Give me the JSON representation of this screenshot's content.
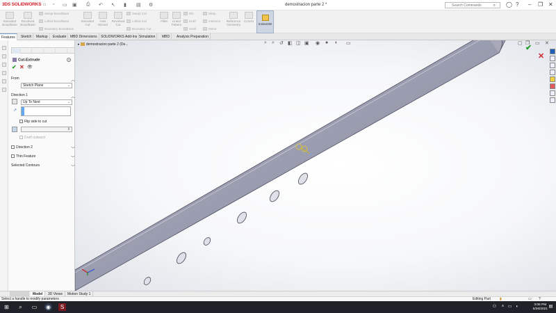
{
  "app": {
    "brand_prefix": "3DS",
    "brand_name": "SOLIDWORKS",
    "document_title": "demostracion parte 2 *"
  },
  "search": {
    "placeholder": "Search Commands"
  },
  "ribbon": {
    "big": [
      {
        "label": "Extruded Boss/Base"
      },
      {
        "label": "Revolved Boss/Base"
      },
      {
        "label": "Extruded Cut"
      },
      {
        "label": "Hole Wizard"
      },
      {
        "label": "Revolved Cut"
      },
      {
        "label": "Fillet"
      },
      {
        "label": "Linear Pattern"
      },
      {
        "label": "Reference Geometry"
      },
      {
        "label": "Curves"
      },
      {
        "label": "Instant3D"
      }
    ],
    "small": [
      {
        "label": "Swept Boss/Base"
      },
      {
        "label": "Lofted Boss/Base"
      },
      {
        "label": "Boundary Boss/Base"
      },
      {
        "label": "Swept Cut"
      },
      {
        "label": "Lofted Cut"
      },
      {
        "label": "Boundary Cut"
      },
      {
        "label": "Rib"
      },
      {
        "label": "Draft"
      },
      {
        "label": "Shell"
      },
      {
        "label": "Wrap"
      },
      {
        "label": "Intersect"
      },
      {
        "label": "Mirror"
      }
    ]
  },
  "tabs": [
    {
      "label": "Features"
    },
    {
      "label": "Sketch"
    },
    {
      "label": "Markup"
    },
    {
      "label": "Evaluate"
    },
    {
      "label": "MBD Dimensions"
    },
    {
      "label": "SOLIDWORKS Add-Ins"
    },
    {
      "label": "Simulation"
    },
    {
      "label": "MBD"
    },
    {
      "label": "Analysis Preparation"
    }
  ],
  "property_manager": {
    "title": "Cut-Extrude",
    "help": "?",
    "from": {
      "label": "From",
      "value": "Sketch Plane"
    },
    "direction1": {
      "label": "Direction 1",
      "end_condition": "Up To Next",
      "flip_label": "Flip side to cut",
      "draft_label": "Draft outward"
    },
    "direction2": {
      "label": "Direction 2"
    },
    "thin_feature": {
      "label": "Thin Feature"
    },
    "selected_contours": {
      "label": "Selected Contours"
    }
  },
  "viewport": {
    "tree_label": "demostracion parte 2  (De..."
  },
  "bottom_tabs": [
    {
      "label": "Model"
    },
    {
      "label": "3D Views"
    },
    {
      "label": "Motion Study 1"
    }
  ],
  "status": {
    "message": "Select a handle to modify parameters",
    "mode": "Editing Part"
  },
  "taskbar": {
    "time": "3:06 PM",
    "date": "5/26/2021"
  },
  "colors": {
    "accent": "#d4202a",
    "tube_body": "#9a9caf",
    "tube_highlight": "#b8bac8",
    "ok_green": "#2a9a2a",
    "cancel_red": "#c72b2b"
  }
}
